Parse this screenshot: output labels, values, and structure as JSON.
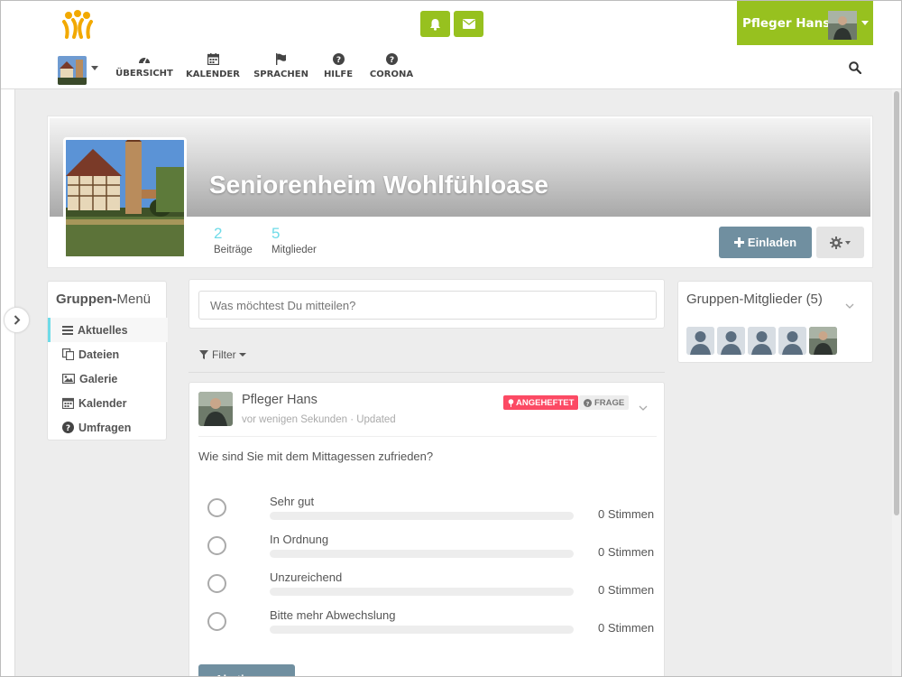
{
  "user": {
    "name": "Pfleger Hans"
  },
  "nav": [
    {
      "label": "ÜBERSICHT",
      "icon": "dashboard-icon"
    },
    {
      "label": "KALENDER",
      "icon": "calendar-icon"
    },
    {
      "label": "SPRACHEN",
      "icon": "flag-icon"
    },
    {
      "label": "HILFE",
      "icon": "question-circle-icon"
    },
    {
      "label": "CORONA",
      "icon": "question-circle-icon"
    }
  ],
  "space": {
    "title": "Seniorenheim Wohlfühloase",
    "stats": [
      {
        "value": "2",
        "label": "Beiträge"
      },
      {
        "value": "5",
        "label": "Mitglieder"
      }
    ],
    "invite_label": "Einladen"
  },
  "group_menu": {
    "title_bold": "Gruppen-",
    "title_rest": "Menü",
    "items": [
      {
        "label": "Aktuelles",
        "icon": "list-icon",
        "active": true
      },
      {
        "label": "Dateien",
        "icon": "files-icon"
      },
      {
        "label": "Galerie",
        "icon": "image-icon"
      },
      {
        "label": "Kalender",
        "icon": "calendar-icon"
      },
      {
        "label": "Umfragen",
        "icon": "question-circle-icon"
      }
    ]
  },
  "composer": {
    "placeholder": "Was möchtest Du mitteilen?"
  },
  "filter": {
    "label": "Filter"
  },
  "post": {
    "author": "Pfleger Hans",
    "meta": "vor wenigen Sekunden · Updated",
    "badge_pinned": "ANGEHEFTET",
    "badge_question": "FRAGE",
    "question": "Wie sind Sie mit dem Mittagessen zufrieden?",
    "options": [
      {
        "label": "Sehr gut",
        "votes": "0 Stimmen",
        "fraction": 0
      },
      {
        "label": "In Ordnung",
        "votes": "0 Stimmen",
        "fraction": 0
      },
      {
        "label": "Unzureichend",
        "votes": "0 Stimmen",
        "fraction": 0
      },
      {
        "label": "Bitte mehr Abwechslung",
        "votes": "0 Stimmen",
        "fraction": 0
      }
    ],
    "vote_label": "Abstimmen"
  },
  "members": {
    "title_bold": "Gruppen-",
    "title_rest": "Mitglieder (5)"
  },
  "colors": {
    "brand_green": "#97c11f",
    "accent_cyan": "#6fdbe8",
    "button_slate": "#708fa0",
    "badge_red": "#fc4a64"
  }
}
